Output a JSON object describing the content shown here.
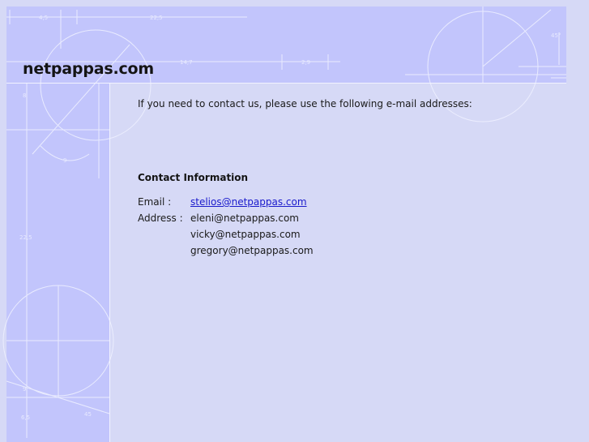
{
  "site": {
    "title": "netpappas.com"
  },
  "main": {
    "intro": "If you need to contact us, please use the following e-mail addresses:",
    "contact_heading": "Contact Information",
    "email_label": "Email :",
    "email_link": "stelios@netpappas.com",
    "address_label": "Address :",
    "addresses": [
      "eleni@netpappas.com",
      "vicky@netpappas.com",
      "gregory@netpappas.com"
    ]
  },
  "blueprint": {
    "dimension_labels": [
      "4,5",
      "22,5",
      "14,7",
      "2,9",
      "45°",
      "9",
      "8",
      "22,5",
      "9",
      "6,5",
      "45"
    ]
  },
  "colors": {
    "background": "#d6d9f6",
    "blueprint": "#c2c5fc",
    "line": "#f2f3ff",
    "link": "#1a1acc"
  }
}
